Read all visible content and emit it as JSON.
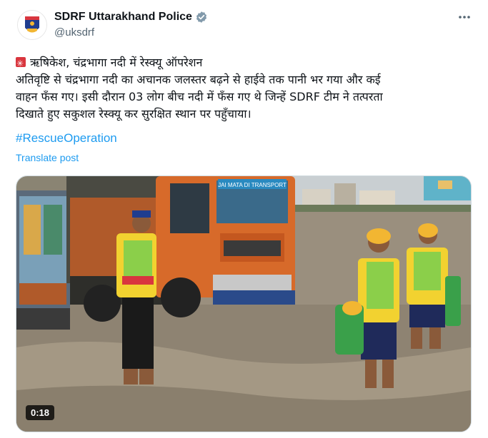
{
  "author": {
    "name": "SDRF Uttarakhand Police",
    "handle": "@uksdrf",
    "avatar_text": "SDRF"
  },
  "post": {
    "line1": "ऋषिकेश, चंद्रभागा नदी में रेस्क्यू ऑपरेशन",
    "line2": "अतिवृष्टि से चंद्रभागा नदी का अचानक जलस्तर बढ़ने से हाईवे तक पानी भर गया और कई",
    "line3": "वाहन फँस गए। इसी दौरान 03 लोग बीच नदी में फँस गए थे जिन्हें SDRF टीम ने तत्परता",
    "line4": "दिखाते हुए सकुशल रेस्क्यू कर सुरक्षित स्थान पर पहुँचाया।",
    "hashtag": "#RescueOperation",
    "translate_label": "Translate post"
  },
  "media": {
    "duration": "0:18",
    "truck_sign": "JAI MATA DI TRANSPORT"
  },
  "colors": {
    "link": "#1d9bf0",
    "verified": "#829aab",
    "siren": "#d9363e"
  }
}
